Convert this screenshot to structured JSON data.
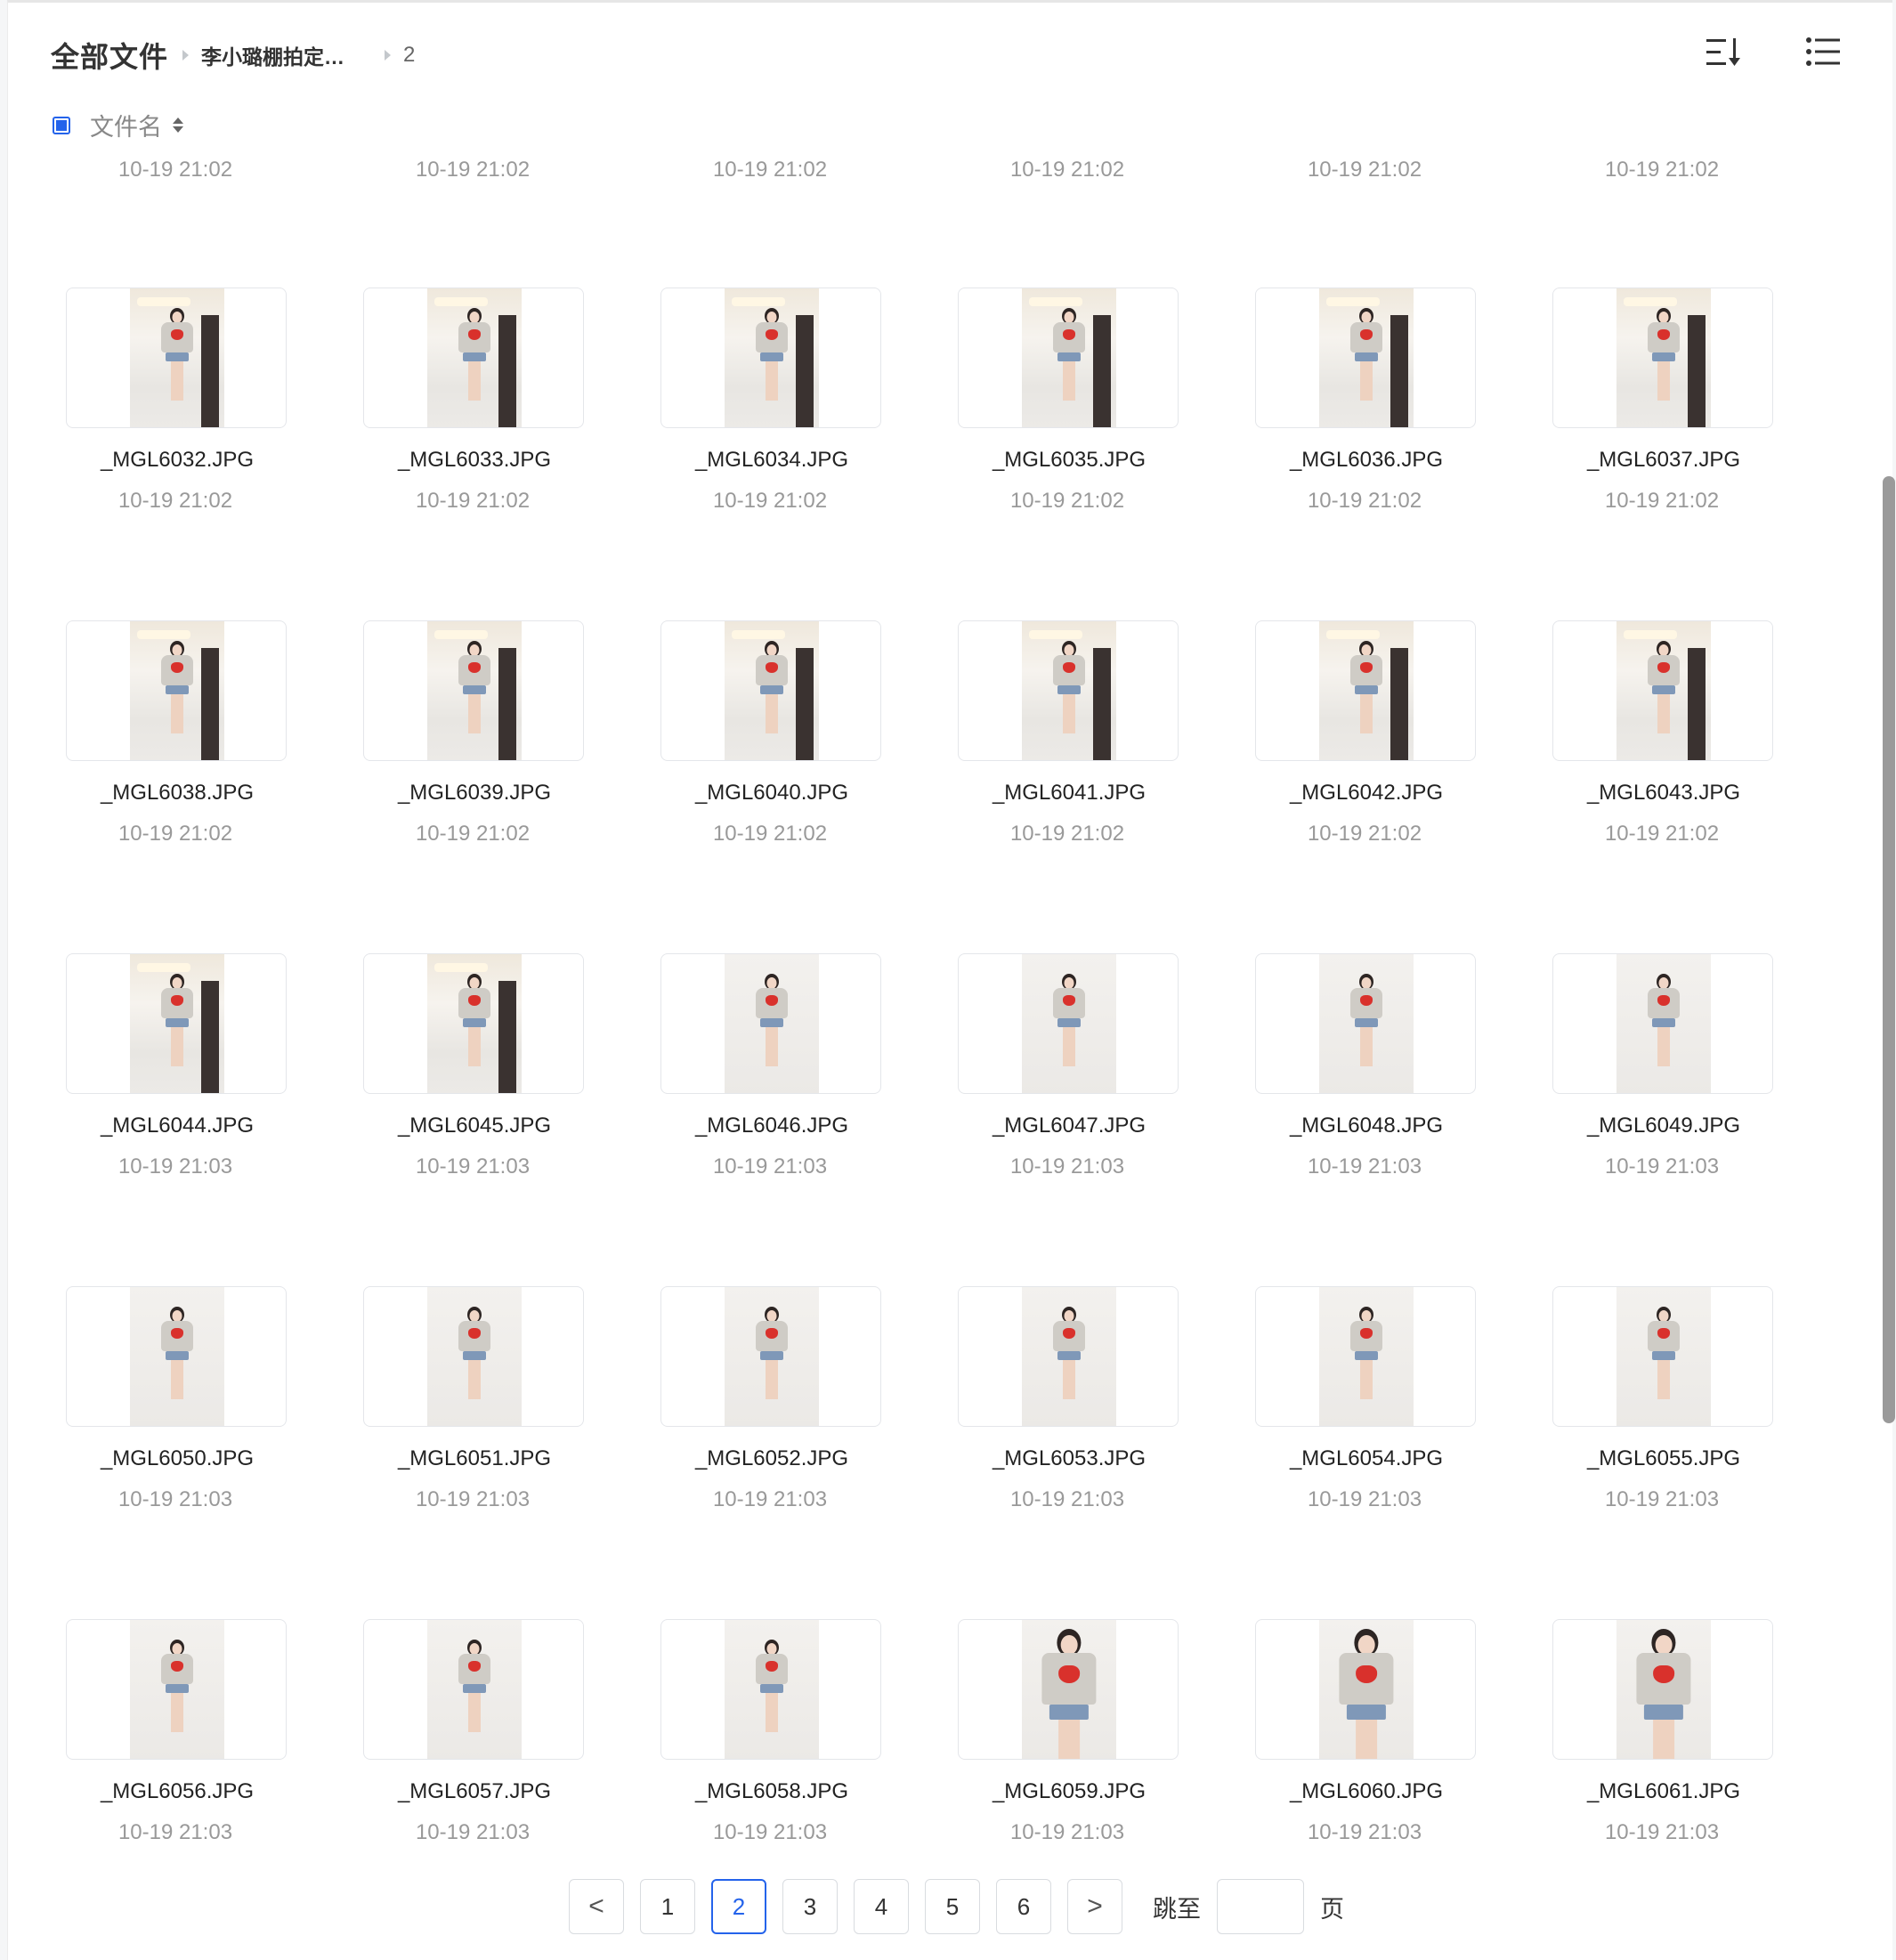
{
  "breadcrumb": {
    "root": "全部文件",
    "middle": "李小璐棚拍定…",
    "current": "2"
  },
  "toolbar": {
    "sort_icon": "sort-icon",
    "list_view_icon": "list-view-icon"
  },
  "column_header": {
    "label": "文件名"
  },
  "previous_row_times": [
    "10-19 21:02",
    "10-19 21:02",
    "10-19 21:02",
    "10-19 21:02",
    "10-19 21:02",
    "10-19 21:02"
  ],
  "files": [
    {
      "name": "_MGL6032.JPG",
      "time": "10-19 21:02"
    },
    {
      "name": "_MGL6033.JPG",
      "time": "10-19 21:02"
    },
    {
      "name": "_MGL6034.JPG",
      "time": "10-19 21:02"
    },
    {
      "name": "_MGL6035.JPG",
      "time": "10-19 21:02"
    },
    {
      "name": "_MGL6036.JPG",
      "time": "10-19 21:02"
    },
    {
      "name": "_MGL6037.JPG",
      "time": "10-19 21:02"
    },
    {
      "name": "_MGL6038.JPG",
      "time": "10-19 21:02"
    },
    {
      "name": "_MGL6039.JPG",
      "time": "10-19 21:02"
    },
    {
      "name": "_MGL6040.JPG",
      "time": "10-19 21:02"
    },
    {
      "name": "_MGL6041.JPG",
      "time": "10-19 21:02"
    },
    {
      "name": "_MGL6042.JPG",
      "time": "10-19 21:02"
    },
    {
      "name": "_MGL6043.JPG",
      "time": "10-19 21:02"
    },
    {
      "name": "_MGL6044.JPG",
      "time": "10-19 21:03"
    },
    {
      "name": "_MGL6045.JPG",
      "time": "10-19 21:03"
    },
    {
      "name": "_MGL6046.JPG",
      "time": "10-19 21:03"
    },
    {
      "name": "_MGL6047.JPG",
      "time": "10-19 21:03"
    },
    {
      "name": "_MGL6048.JPG",
      "time": "10-19 21:03"
    },
    {
      "name": "_MGL6049.JPG",
      "time": "10-19 21:03"
    },
    {
      "name": "_MGL6050.JPG",
      "time": "10-19 21:03"
    },
    {
      "name": "_MGL6051.JPG",
      "time": "10-19 21:03"
    },
    {
      "name": "_MGL6052.JPG",
      "time": "10-19 21:03"
    },
    {
      "name": "_MGL6053.JPG",
      "time": "10-19 21:03"
    },
    {
      "name": "_MGL6054.JPG",
      "time": "10-19 21:03"
    },
    {
      "name": "_MGL6055.JPG",
      "time": "10-19 21:03"
    },
    {
      "name": "_MGL6056.JPG",
      "time": "10-19 21:03"
    },
    {
      "name": "_MGL6057.JPG",
      "time": "10-19 21:03"
    },
    {
      "name": "_MGL6058.JPG",
      "time": "10-19 21:03"
    },
    {
      "name": "_MGL6059.JPG",
      "time": "10-19 21:03"
    },
    {
      "name": "_MGL6060.JPG",
      "time": "10-19 21:03"
    },
    {
      "name": "_MGL6061.JPG",
      "time": "10-19 21:03"
    }
  ],
  "pagination": {
    "prev": "<",
    "pages": [
      "1",
      "2",
      "3",
      "4",
      "5",
      "6"
    ],
    "current_page": "2",
    "next": ">",
    "jump_label": "跳至",
    "jump_value": "",
    "page_suffix": "页"
  },
  "colors": {
    "accent": "#2463eb",
    "muted_text": "#999999"
  }
}
